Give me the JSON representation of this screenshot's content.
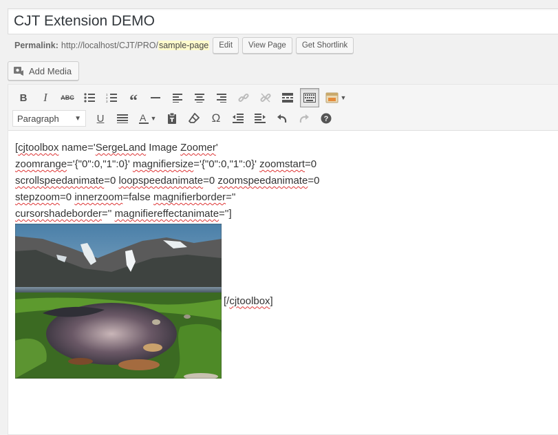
{
  "post": {
    "title": "CJT Extension DEMO"
  },
  "permalink": {
    "label": "Permalink:",
    "base_url": "http://localhost/CJT/PRO/",
    "slug": "sample-page",
    "edit_label": "Edit",
    "view_label": "View Page",
    "shortlink_label": "Get Shortlink"
  },
  "media": {
    "add_media_label": "Add Media"
  },
  "toolbar": {
    "format_select": "Paragraph",
    "row1_icons": [
      "bold-icon",
      "italic-icon",
      "strikethrough-icon",
      "bullet-list-icon",
      "numbered-list-icon",
      "blockquote-icon",
      "horizontal-line-icon",
      "align-left-icon",
      "align-center-icon",
      "align-right-icon",
      "link-icon",
      "unlink-icon",
      "read-more-icon",
      "toolbar-toggle-icon",
      "cjt-icon"
    ],
    "row2_icons": [
      "underline-icon",
      "justify-icon",
      "text-color-icon",
      "paste-text-icon",
      "clear-format-icon",
      "special-char-icon",
      "outdent-icon",
      "indent-icon",
      "undo-icon",
      "redo-icon",
      "help-icon"
    ]
  },
  "content": {
    "line1": [
      "[",
      "cjtoolbox",
      " name='",
      "SergeLand",
      " Image ",
      "Zoomer",
      "'"
    ],
    "line2": [
      "zoomrange",
      "='{\"0\":0,\"1\":0}' ",
      "magnifiersize",
      "='{\"0\":0,\"1\":0}' ",
      "zoomstart",
      "=0"
    ],
    "line3": [
      "scrollspeedanimate",
      "=0 ",
      "loopspeedanimate",
      "=0 ",
      "zoomspeedanimate",
      "=0"
    ],
    "line4": [
      "stepzoom",
      "=0 ",
      "innerzoom",
      "=false ",
      "magnifierborder",
      "=''"
    ],
    "line5": [
      "cursorshadeborder",
      "='' ",
      "magnifiereffectanimate",
      "='']"
    ],
    "closing": [
      "[/",
      "cjtoolbox",
      "]"
    ]
  }
}
